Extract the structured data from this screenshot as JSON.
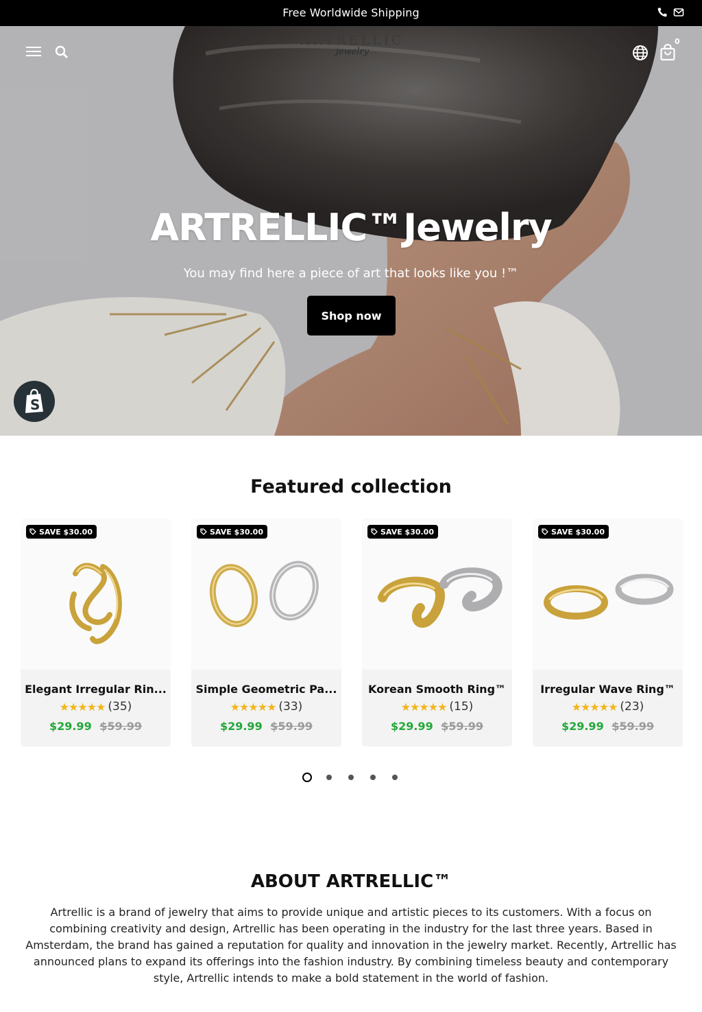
{
  "announcement": {
    "text": "Free Worldwide Shipping"
  },
  "header": {
    "logo_top": "ARTRELLIC",
    "logo_script": "jewelry",
    "cart_count": "0"
  },
  "hero": {
    "title": "ARTRELLIC™Jewelry",
    "subtitle": "You may find here a piece of art that looks like you !™",
    "cta": "Shop now"
  },
  "featured": {
    "title": "Featured collection",
    "products": [
      {
        "badge": "SAVE $30.00",
        "name": "Elegant Irregular Rin...",
        "stars": "★★★★★",
        "reviews": "(35)",
        "price": "$29.99",
        "compare_price": "$59.99"
      },
      {
        "badge": "SAVE $30.00",
        "name": "Simple Geometric Pa...",
        "stars": "★★★★★",
        "reviews": "(33)",
        "price": "$29.99",
        "compare_price": "$59.99"
      },
      {
        "badge": "SAVE $30.00",
        "name": "Korean Smooth Ring™",
        "stars": "★★★★★",
        "reviews": "(15)",
        "price": "$29.99",
        "compare_price": "$59.99"
      },
      {
        "badge": "SAVE $30.00",
        "name": "Irregular Wave Ring™",
        "stars": "★★★★★",
        "reviews": "(23)",
        "price": "$29.99",
        "compare_price": "$59.99"
      }
    ],
    "pagination": {
      "pages": 5,
      "active": 1
    }
  },
  "about": {
    "title": "ABOUT ARTRELLIC™",
    "text": "Artrellic is a brand of jewelry that aims to provide unique and artistic pieces to its customers. With a focus on combining creativity and design, Artrellic has been operating in the industry for the last three years. Based in Amsterdam, the brand has gained a reputation for quality and innovation in the jewelry market. Recently, Artrellic has announced plans to expand its offerings into the fashion industry. By combining timeless beauty and contemporary style, Artrellic intends to make a bold statement in the world of fashion."
  },
  "colors": {
    "accent": "#000000",
    "sale_price": "#23a83a",
    "star": "#f2b51b",
    "shopify_badge": "#263238"
  }
}
